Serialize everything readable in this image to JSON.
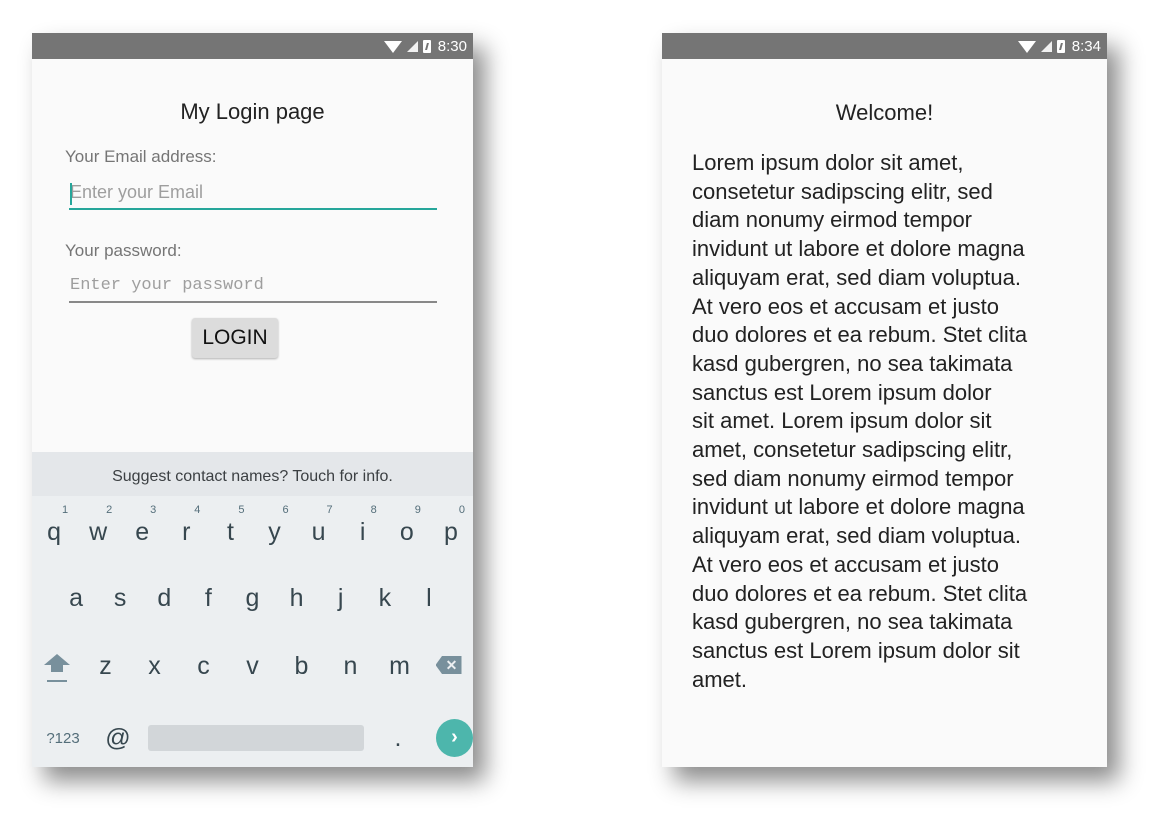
{
  "login_screen": {
    "status_bar": {
      "time": "8:30",
      "icons": [
        "wifi-icon",
        "signal-icon",
        "battery-charging-icon"
      ]
    },
    "title": "My Login page",
    "email_label": "Your Email address:",
    "email_placeholder": "Enter your Email",
    "password_label": "Your password:",
    "password_placeholder": "Enter your password",
    "login_button": "LOGIN",
    "accent_color": "#26a69a",
    "keyboard": {
      "suggestion": "Suggest contact names? Touch for info.",
      "row1": [
        {
          "key": "q",
          "hint": "1"
        },
        {
          "key": "w",
          "hint": "2"
        },
        {
          "key": "e",
          "hint": "3"
        },
        {
          "key": "r",
          "hint": "4"
        },
        {
          "key": "t",
          "hint": "5"
        },
        {
          "key": "y",
          "hint": "6"
        },
        {
          "key": "u",
          "hint": "7"
        },
        {
          "key": "i",
          "hint": "8"
        },
        {
          "key": "o",
          "hint": "9"
        },
        {
          "key": "p",
          "hint": "0"
        }
      ],
      "row2": [
        "a",
        "s",
        "d",
        "f",
        "g",
        "h",
        "j",
        "k",
        "l"
      ],
      "row3": [
        "z",
        "x",
        "c",
        "v",
        "b",
        "n",
        "m"
      ],
      "symbols_key": "?123",
      "at_key": "@",
      "period_key": ".",
      "go_key": "›",
      "backspace_glyph": "✕"
    }
  },
  "welcome_screen": {
    "status_bar": {
      "time": "8:34",
      "icons": [
        "wifi-icon",
        "signal-icon",
        "battery-charging-icon"
      ]
    },
    "title": "Welcome!",
    "body_lines": [
      "Lorem ipsum dolor sit amet,",
      "consetetur sadipscing elitr, sed",
      "diam nonumy eirmod tempor",
      "invidunt ut labore et dolore magna",
      "aliquyam erat, sed diam voluptua.",
      "At vero eos et accusam et justo",
      "duo dolores et ea rebum. Stet clita",
      "kasd gubergren, no sea takimata",
      "sanctus est Lorem ipsum dolor",
      "sit amet. Lorem ipsum dolor sit",
      "amet, consetetur sadipscing elitr,",
      "sed diam nonumy eirmod tempor",
      "invidunt ut labore et dolore magna",
      "aliquyam erat, sed diam voluptua.",
      "At vero eos et accusam et justo",
      "duo dolores et ea rebum. Stet clita",
      "kasd gubergren, no sea takimata",
      "sanctus est Lorem ipsum dolor sit",
      "amet."
    ]
  }
}
